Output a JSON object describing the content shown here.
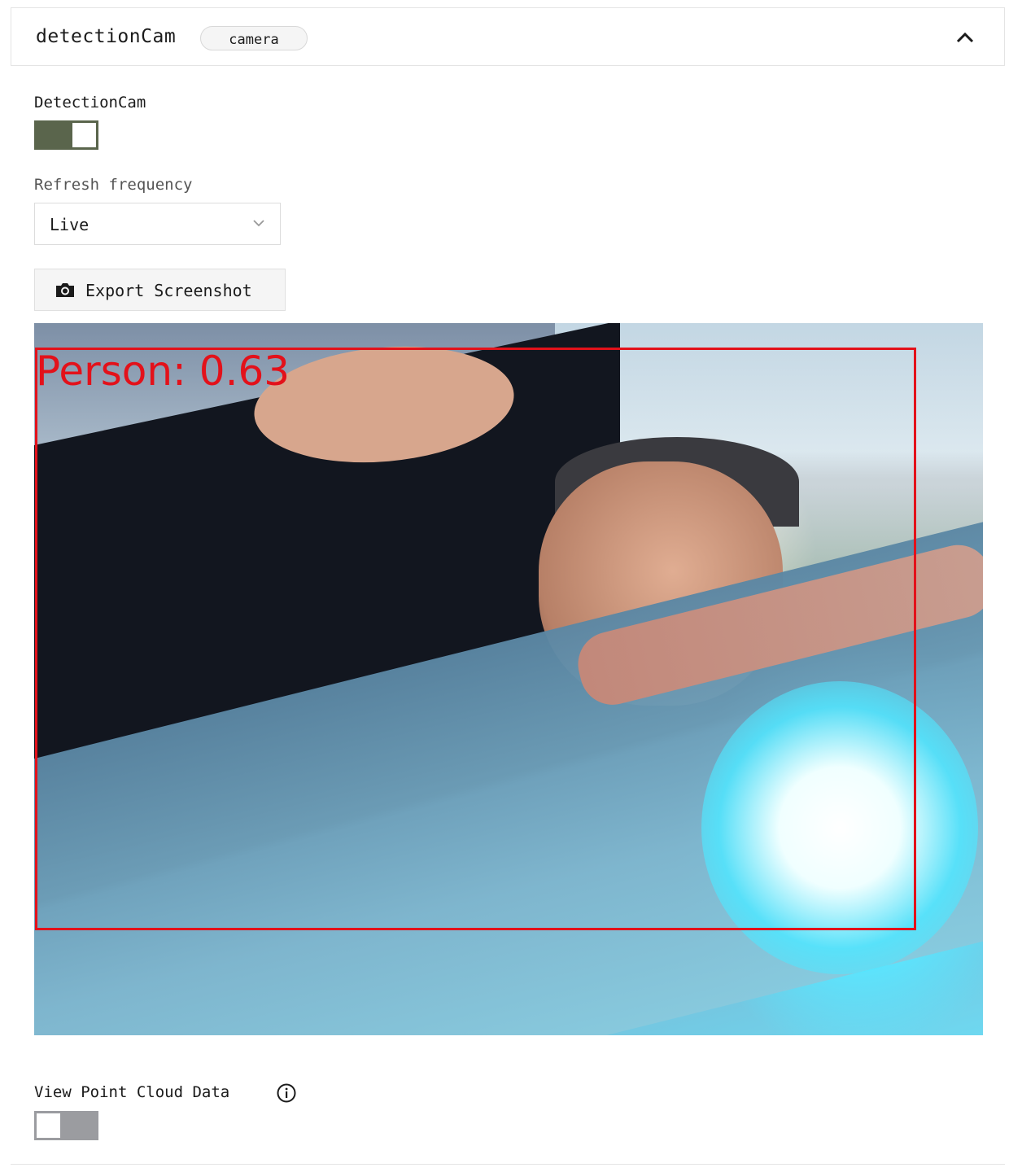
{
  "header": {
    "title": "detectionCam",
    "badge": "camera",
    "collapse_icon": "chevron-up-icon"
  },
  "stream_toggle": {
    "label": "DetectionCam",
    "on": true,
    "color": "#5a654c"
  },
  "refresh": {
    "label": "Refresh frequency",
    "selected": "Live",
    "icon": "chevron-down-icon"
  },
  "export_button": {
    "label": "Export Screenshot",
    "icon": "camera-icon"
  },
  "camera_feed": {
    "detections": [
      {
        "label": "Person: 0.63",
        "color": "#e3111a"
      }
    ]
  },
  "point_cloud": {
    "label": "View Point Cloud Data",
    "on": false,
    "icon": "info-icon"
  }
}
